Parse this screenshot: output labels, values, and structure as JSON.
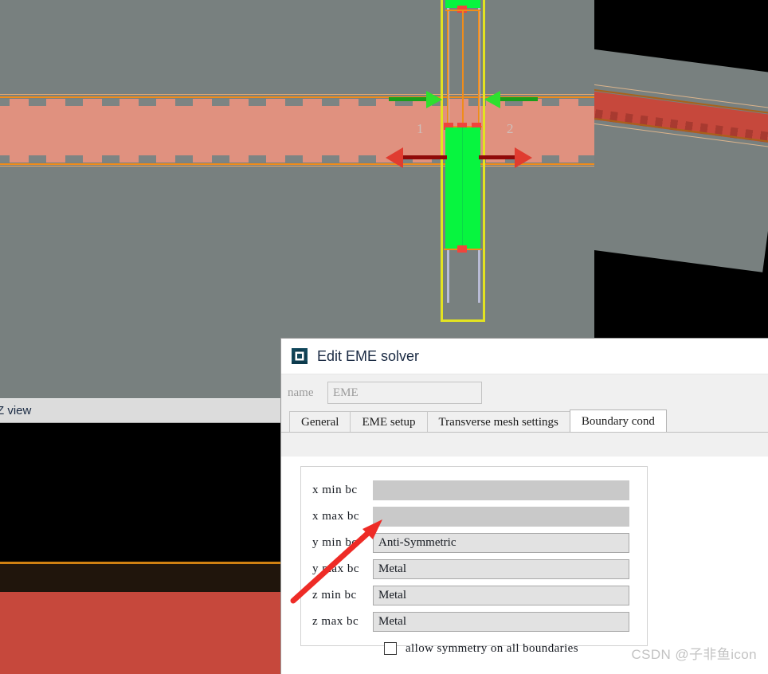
{
  "viewport_top": {
    "name": "cad-cross-section-view",
    "port_labels": [
      "1",
      "2"
    ],
    "colors": {
      "background": "#78807f",
      "slab": "#e0917f",
      "slab_outline": "#f08c1a",
      "eme_region_outline": "#e3e321",
      "eme_cell": "#07f53f",
      "handle": "#f0453c",
      "mode_source_arrow": "#2ee02e",
      "port_arrow": "#e03c30",
      "port_arrow_bar": "#8f0a09"
    }
  },
  "viewport_3d": {
    "name": "perspective-view",
    "colors": {
      "background": "#000000",
      "cladding": "#78807f",
      "core": "#c6483c",
      "outline": "#a8621a"
    }
  },
  "panel_bottom": {
    "title": "Z view",
    "colors": {
      "titlebar": "#dcdcdc",
      "view_background": "#000000",
      "divider": "#cf8012",
      "layer_dark": "#20150c",
      "layer_brick": "#c6483c"
    }
  },
  "dialog": {
    "title": "Edit EME solver",
    "icon": "lumerical-solver-icon",
    "name_field": {
      "label": "name",
      "value": "EME",
      "placeholder": "EME",
      "disabled": true
    },
    "tabs": [
      {
        "label": "General",
        "active": false
      },
      {
        "label": "EME setup",
        "active": false
      },
      {
        "label": "Transverse mesh settings",
        "active": false
      },
      {
        "label": "Boundary cond",
        "active": true
      }
    ],
    "boundary_conditions": {
      "fields": [
        {
          "label": "x min bc",
          "value": "",
          "disabled": true
        },
        {
          "label": "x max bc",
          "value": "",
          "disabled": true
        },
        {
          "label": "y min bc",
          "value": "Anti-Symmetric",
          "disabled": false
        },
        {
          "label": "y max bc",
          "value": "Metal",
          "disabled": false
        },
        {
          "label": "z min bc",
          "value": "Metal",
          "disabled": false
        },
        {
          "label": "z max bc",
          "value": "Metal",
          "disabled": false
        }
      ],
      "checkbox": {
        "label": "allow symmetry on all boundaries",
        "checked": false
      }
    }
  },
  "annotation": {
    "name": "red-pointer-arrow",
    "color": "#ee2b26",
    "points_to": "y min bc"
  },
  "watermark": {
    "text": "CSDN @子非鱼icon"
  }
}
